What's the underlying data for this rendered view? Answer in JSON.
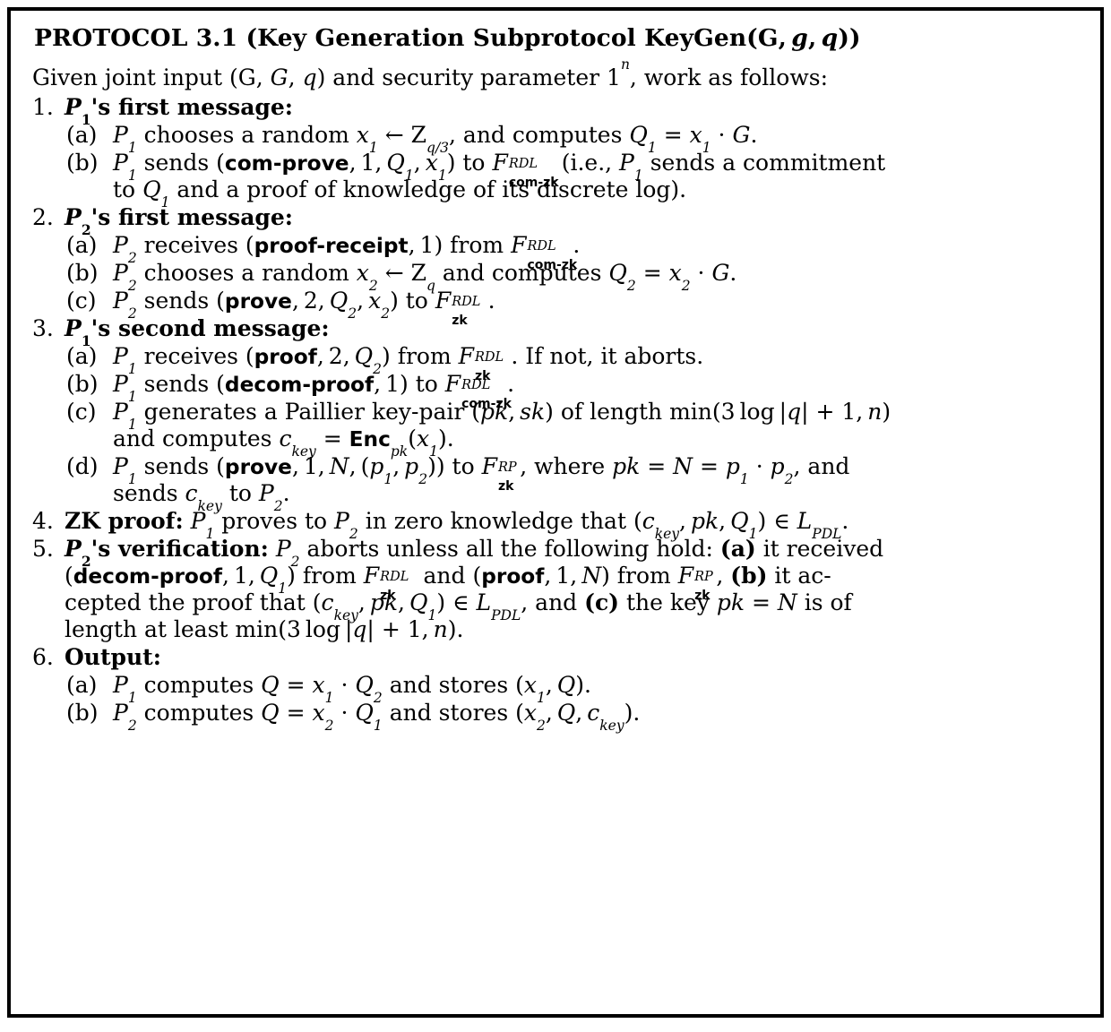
{
  "document": {
    "kind": "protocol-box",
    "title_prefix": "PROTOCOL 3.1",
    "title_full": "PROTOCOL 3.1 (Key Generation Subprotocol KeyGen(G̶, g, q))",
    "title_parts": {
      "label": "PROTOCOL 3.1 (Key Generation Subprotocol KeyGen(",
      "group": "G",
      "comma1": ",",
      "g": "g",
      "comma2": ",",
      "q": "q",
      "close": "))"
    },
    "intro": {
      "before_group": "Given joint input (",
      "group": "G",
      "sep1": ", ",
      "curve": "G",
      "sep2": ", ",
      "order": "q",
      "after": ") and security parameter 1",
      "sec_exp": "n",
      "tail": ", work as follows:"
    },
    "colors": {
      "text": "#000000",
      "background": "#ffffff",
      "border": "#000000"
    },
    "items": [
      {
        "num": "1.",
        "head": "P",
        "head_sub": "1",
        "head_rest": "'s first message:",
        "sub": [
          {
            "label": "(a)",
            "text": "P1 chooses a random x1 ← Zq/3, and computes Q1 = x1 · G."
          },
          {
            "label": "(b)",
            "text": "P1 sends (com-prove, 1, Q1, x1) to F_com-zk^{R_DL} (i.e., P1 sends a commitment to Q1 and a proof of knowledge of its discrete log)."
          }
        ]
      },
      {
        "num": "2.",
        "head": "P",
        "head_sub": "2",
        "head_rest": "'s first message:",
        "sub": [
          {
            "label": "(a)",
            "text": "P2 receives (proof-receipt, 1) from F_com-zk^{R_DL}."
          },
          {
            "label": "(b)",
            "text": "P2 chooses a random x2 ← Zq and computes Q2 = x2 · G."
          },
          {
            "label": "(c)",
            "text": "P2 sends (prove, 2, Q2, x2) to F_zk^{R_DL}."
          }
        ]
      },
      {
        "num": "3.",
        "head": "P",
        "head_sub": "1",
        "head_rest": "'s second message:",
        "sub": [
          {
            "label": "(a)",
            "text": "P1 receives (proof, 2, Q2) from F_zk^{R_DL}. If not, it aborts."
          },
          {
            "label": "(b)",
            "text": "P1 sends (decom-proof, 1) to F_com-zk^{R_DL}."
          },
          {
            "label": "(c)",
            "text": "P1 generates a Paillier key-pair (pk, sk) of length min(3 log |q| + 1, n) and computes c_key = Enc_pk(x1)."
          },
          {
            "label": "(d)",
            "text": "P1 sends (prove, 1, N, (p1, p2)) to F_zk^{R_P}, where pk = N = p1 · p2, and sends c_key to P2."
          }
        ]
      },
      {
        "num": "4.",
        "head_bold": "ZK proof:",
        "text": "P1 proves to P2 in zero knowledge that (c_key, pk, Q1) ∈ L_PDL."
      },
      {
        "num": "5.",
        "head": "P",
        "head_sub": "2",
        "head_rest": "'s verification:",
        "text": "P2 aborts unless all the following hold: (a) it received (decom-proof, 1, Q1) from F_zk^{R_DL} and (proof, 1, N) from F_zk^{R_P}, (b) it accepted the proof that (c_key, pk, Q1) ∈ L_PDL, and (c) the key pk = N is of length at least min(3 log |q| + 1, n)."
      },
      {
        "num": "6.",
        "head_bold": "Output:",
        "sub": [
          {
            "label": "(a)",
            "text": "P1 computes Q = x1 · Q2 and stores (x1, Q)."
          },
          {
            "label": "(b)",
            "text": "P2 computes Q = x2 · Q1 and stores (x2, Q, c_key)."
          }
        ]
      }
    ],
    "literals": {
      "P": "P",
      "Q": "Q",
      "x": "x",
      "N": "N",
      "G": "G",
      "Z": "Z",
      "L": "L",
      "F": "F",
      "one": "1",
      "two": "2",
      "three": "3",
      "q3": "q/3",
      "q": "q",
      "R_DL": "R",
      "DL": "DL",
      "R_P": "R",
      "P_sub": "P",
      "com_zk": "com-zk",
      "zk": "zk",
      "com_prove": "com-prove",
      "proof_receipt": "proof-receipt",
      "prove": "prove",
      "proof": "proof",
      "decom_proof": "decom-proof",
      "Enc": "Enc",
      "pk": "pk",
      "sk": "sk",
      "ckey": "c",
      "key": "key",
      "PDL": "PDL",
      "arrow": "←",
      "cdot": "·",
      "in": "∈",
      "eq": "=",
      "plus": "+",
      "min": "min",
      "log": "log",
      "abs": "|",
      "n": "n",
      "p": "p"
    },
    "phrases": {
      "chooses_random": "chooses a random",
      "and_computes": ", and computes",
      "and_computes2": "and computes",
      "sends": "sends",
      "receives": "receives",
      "to": "to",
      "from": "from",
      "ie": "(i.e.,",
      "sends_commitment": "sends a commitment",
      "to_q1_proof": "and a proof of knowledge of its discrete log).",
      "if_not_aborts": ". If not, it aborts.",
      "generates_paillier": "generates a Paillier key-pair",
      "of_length": "of length",
      "where": ", where",
      "and2": ", and",
      "sends_ckey": "sends",
      "proves_to": "proves to",
      "in_zero_knowledge": "in zero knowledge that",
      "aborts_unless": "aborts unless all the following hold:",
      "it_received": "it received",
      "and": "and",
      "it_accepted": "it ac-",
      "cepted": "cepted the proof that",
      "the_key": "the key",
      "is_of": "is of",
      "length_at_least": "length at least",
      "computes": "computes",
      "and_stores": "and stores",
      "a_bold": "(a)",
      "b_bold": "(b)",
      "c_bold": "(c)"
    }
  }
}
